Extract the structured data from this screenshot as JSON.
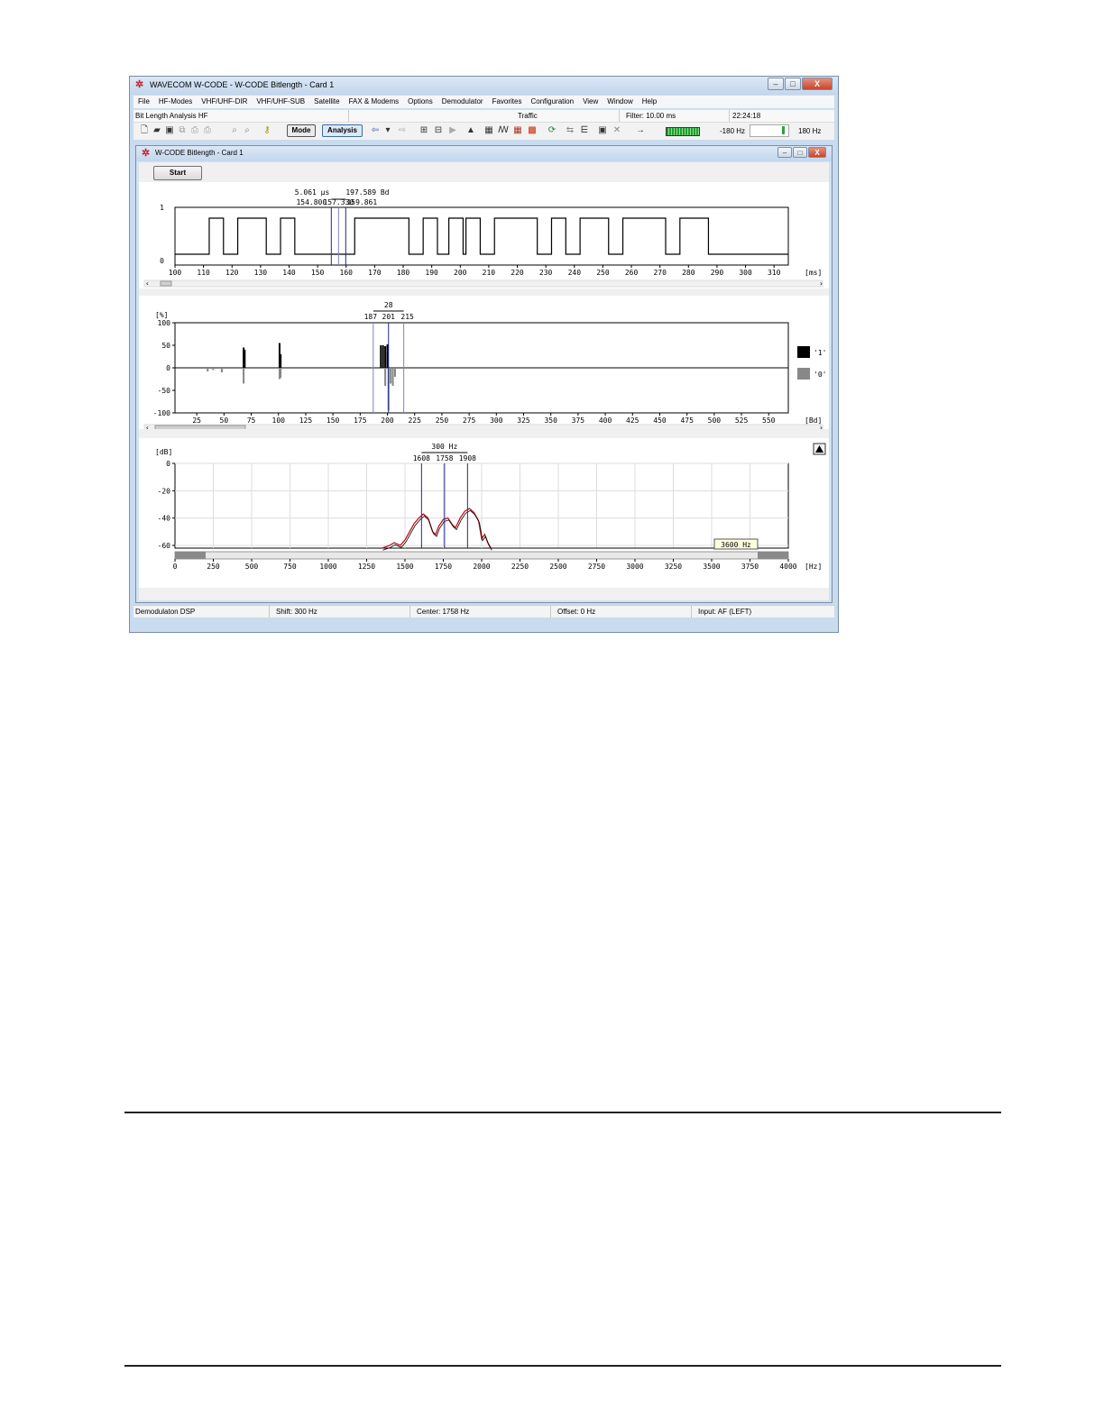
{
  "window": {
    "title": "WAVECOM W-CODE - W-CODE Bitlength  - Card 1",
    "btn_min": "–",
    "btn_max": "□",
    "btn_close": "X"
  },
  "menu": [
    "File",
    "HF-Modes",
    "VHF/UHF-DIR",
    "VHF/UHF-SUB",
    "Satellite",
    "FAX & Modems",
    "Options",
    "Demodulator",
    "Favorites",
    "Configuration",
    "View",
    "Window",
    "Help"
  ],
  "info": {
    "mode": "Bit Length Analysis HF",
    "traffic": "Traffic",
    "filter": "Filter: 10.00 ms",
    "time": "22:24:18"
  },
  "toolbar": {
    "mode_label": "Mode",
    "analysis_label": "Analysis",
    "tuning_left": "-180 Hz",
    "tuning_right": "180 Hz"
  },
  "child": {
    "title": "W-CODE Bitlength  - Card 1",
    "start_label": "Start"
  },
  "chart_data": [
    {
      "type": "line",
      "name": "bit-timing",
      "unit": "[ms]",
      "x_ticks": [
        "100",
        "110",
        "120",
        "130",
        "140",
        "150",
        "160",
        "170",
        "180",
        "190",
        "200",
        "210",
        "220",
        "230",
        "240",
        "250",
        "260",
        "270",
        "280",
        "290",
        "300",
        "310"
      ],
      "y_ticks": [
        "1",
        "0"
      ],
      "xlim": [
        100,
        315
      ],
      "ylim": [
        0,
        1
      ],
      "segments_high": [
        [
          112,
          117
        ],
        [
          122,
          132
        ],
        [
          137,
          142
        ],
        [
          163,
          182
        ],
        [
          187,
          192
        ],
        [
          196,
          201
        ],
        [
          202,
          207
        ],
        [
          212,
          227
        ],
        [
          232,
          237
        ],
        [
          242,
          252
        ],
        [
          257,
          272
        ],
        [
          277,
          287
        ]
      ],
      "cursors": [
        154.8,
        157.33,
        159.861
      ],
      "cursor_labels": [
        "154.800",
        "157.330",
        "159.861"
      ],
      "measure_label_1": "5.061 µs",
      "measure_label_2": "197.589 Bd"
    },
    {
      "type": "bar",
      "name": "baud-histogram",
      "unit": "[Bd]",
      "y_unit": "[%]",
      "x_ticks": [
        "25",
        "50",
        "75",
        "100",
        "125",
        "150",
        "175",
        "200",
        "225",
        "250",
        "275",
        "300",
        "325",
        "350",
        "375",
        "400",
        "425",
        "450",
        "475",
        "500",
        "525",
        "550"
      ],
      "y_ticks": [
        "100",
        "50",
        "0",
        "-50",
        "-100"
      ],
      "xlim": [
        5,
        568
      ],
      "ylim": [
        -100,
        100
      ],
      "ones": [
        [
          68,
          45
        ],
        [
          69,
          40
        ],
        [
          101,
          55
        ],
        [
          102,
          30
        ],
        [
          194,
          50
        ],
        [
          196,
          50
        ],
        [
          198,
          48
        ],
        [
          200,
          52
        ]
      ],
      "zeros": [
        [
          35,
          -8
        ],
        [
          40,
          -5
        ],
        [
          48,
          -10
        ],
        [
          68,
          -35
        ],
        [
          101,
          -25
        ],
        [
          102,
          -22
        ],
        [
          198,
          -40
        ],
        [
          201,
          -95
        ],
        [
          203,
          -35
        ],
        [
          205,
          -40
        ],
        [
          207,
          -20
        ]
      ],
      "cursors": [
        187,
        201,
        215
      ],
      "cursor_labels": [
        "187",
        "201",
        "215"
      ],
      "span_label": "28",
      "legend": [
        "'1'",
        "'0'"
      ]
    },
    {
      "type": "line",
      "name": "spectrum",
      "unit": "[Hz]",
      "y_unit": "[dB]",
      "x_ticks": [
        "0",
        "250",
        "500",
        "750",
        "1000",
        "1250",
        "1500",
        "1750",
        "2000",
        "2250",
        "2500",
        "2750",
        "3000",
        "3250",
        "3500",
        "3750",
        "4000"
      ],
      "y_ticks": [
        "0",
        "-20",
        "-40",
        "-60"
      ],
      "xlim": [
        0,
        4000
      ],
      "ylim": [
        -62,
        0
      ],
      "spectrum": [
        [
          1350,
          -62
        ],
        [
          1400,
          -60
        ],
        [
          1430,
          -58
        ],
        [
          1470,
          -60
        ],
        [
          1500,
          -56
        ],
        [
          1530,
          -50
        ],
        [
          1560,
          -44
        ],
        [
          1590,
          -40
        ],
        [
          1620,
          -37
        ],
        [
          1650,
          -40
        ],
        [
          1680,
          -50
        ],
        [
          1700,
          -52
        ],
        [
          1720,
          -46
        ],
        [
          1750,
          -41
        ],
        [
          1780,
          -40
        ],
        [
          1810,
          -45
        ],
        [
          1830,
          -47
        ],
        [
          1860,
          -40
        ],
        [
          1890,
          -35
        ],
        [
          1920,
          -33
        ],
        [
          1950,
          -36
        ],
        [
          1980,
          -42
        ],
        [
          2000,
          -55
        ],
        [
          2020,
          -52
        ],
        [
          2040,
          -58
        ],
        [
          2060,
          -62
        ]
      ],
      "cursors": [
        1608,
        1758,
        1908
      ],
      "cursor_labels": [
        "1608",
        "1758",
        "1908"
      ],
      "span_label": "300 Hz",
      "tooltip": "3600 Hz"
    }
  ],
  "status": {
    "demod": "Demodulaton DSP",
    "shift": "Shift: 300 Hz",
    "center": "Center: 1758 Hz",
    "offset": "Offset: 0 Hz",
    "input": "Input: AF (LEFT)"
  },
  "colors": {
    "cursor": "#1e2a8c",
    "cursor_light": "#7a7fd0",
    "signal": "#000000",
    "spectrum_red": "#c0121b",
    "bar_zero": "#888888"
  }
}
